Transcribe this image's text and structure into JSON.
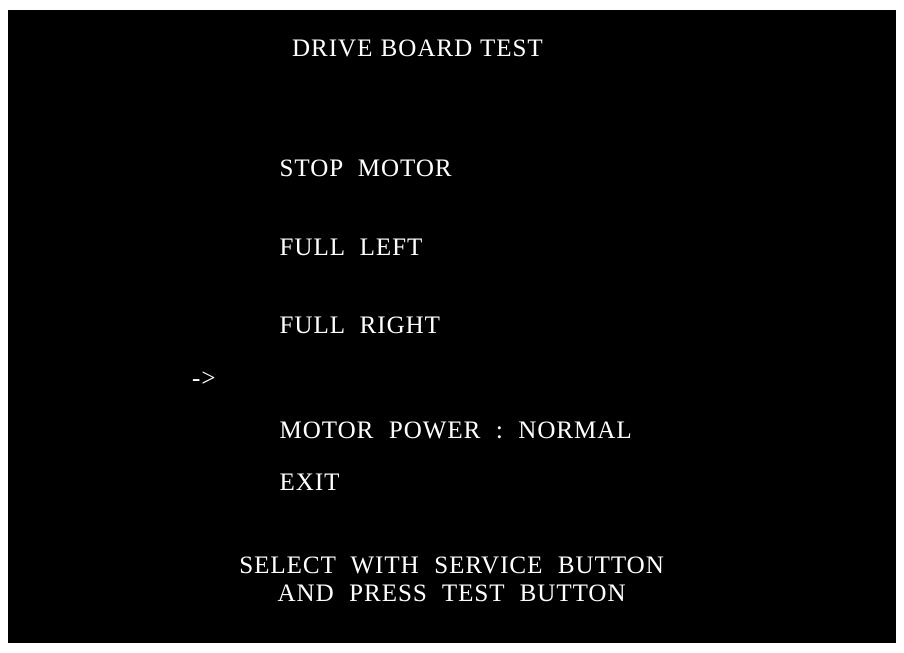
{
  "screen": {
    "title": "DRIVE BOARD TEST",
    "cursor": "->",
    "menu": {
      "items": [
        {
          "label": "STOP  MOTOR"
        },
        {
          "label": "FULL  LEFT"
        },
        {
          "label": "FULL  RIGHT"
        },
        {
          "label": "MOTOR  POWER  :  NORMAL"
        },
        {
          "label": "EXIT"
        }
      ],
      "selected_index": 3
    },
    "footer": {
      "line1": "SELECT  WITH  SERVICE  BUTTON",
      "line2": "AND  PRESS  TEST  BUTTON"
    }
  },
  "colors": {
    "background": "#000000",
    "text": "#ffffff"
  }
}
